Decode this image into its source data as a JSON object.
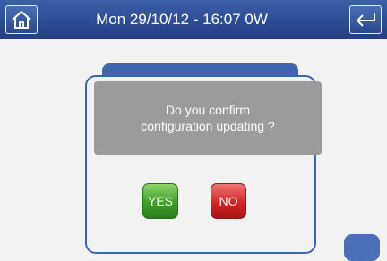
{
  "header": {
    "status_text": "Mon 29/10/12 - 16:07   0W"
  },
  "dialog": {
    "message_lines": [
      "Do you confirm",
      "configuration updating ?"
    ],
    "yes_label": "YES",
    "no_label": "NO"
  },
  "icons": {
    "home": "home-icon",
    "back": "return-arrow-icon"
  },
  "colors": {
    "header": "#2d4c94",
    "dialog_border": "#3b63b0",
    "message_background": "#9b9b9b",
    "yes": "#3e9e2a",
    "no": "#d12525"
  }
}
